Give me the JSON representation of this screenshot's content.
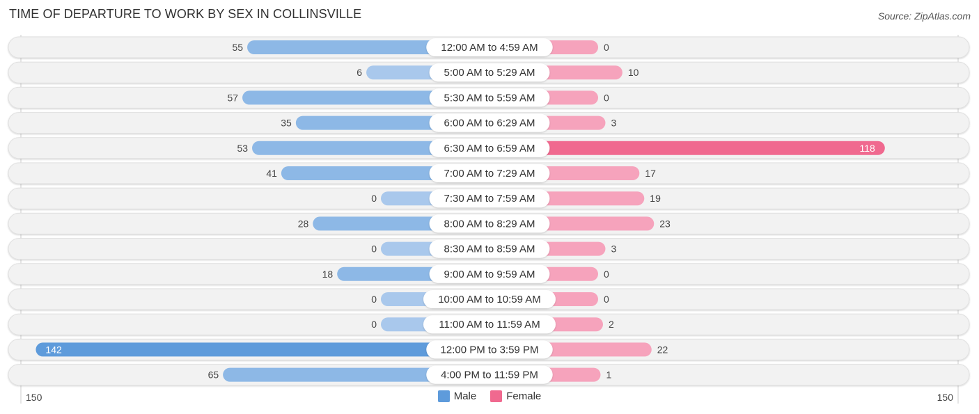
{
  "header": {
    "title": "TIME OF DEPARTURE TO WORK BY SEX IN COLLINSVILLE",
    "source": "Source: ZipAtlas.com"
  },
  "colors": {
    "male": "#8db8e6",
    "male_light": "#a9c8ec",
    "male_strong": "#5e9bdb",
    "female": "#f6a3bc",
    "female_strong": "#f0698f",
    "row_bg": "#f2f2f2"
  },
  "legend": {
    "male_label": "Male",
    "female_label": "Female"
  },
  "axis": {
    "left_label": "150",
    "right_label": "150"
  },
  "chart_data": {
    "type": "bar",
    "orientation": "horizontal-diverging",
    "title": "TIME OF DEPARTURE TO WORK BY SEX IN COLLINSVILLE",
    "xlim": [
      -150,
      150
    ],
    "legend_position": "bottom-center",
    "categories": [
      "12:00 AM to 4:59 AM",
      "5:00 AM to 5:29 AM",
      "5:30 AM to 5:59 AM",
      "6:00 AM to 6:29 AM",
      "6:30 AM to 6:59 AM",
      "7:00 AM to 7:29 AM",
      "7:30 AM to 7:59 AM",
      "8:00 AM to 8:29 AM",
      "8:30 AM to 8:59 AM",
      "9:00 AM to 9:59 AM",
      "10:00 AM to 10:59 AM",
      "11:00 AM to 11:59 AM",
      "12:00 PM to 3:59 PM",
      "4:00 PM to 11:59 PM"
    ],
    "series": [
      {
        "name": "Male",
        "values": [
          55,
          6,
          57,
          35,
          53,
          41,
          0,
          28,
          0,
          18,
          0,
          0,
          142,
          65
        ]
      },
      {
        "name": "Female",
        "values": [
          0,
          10,
          0,
          3,
          118,
          17,
          19,
          23,
          3,
          0,
          0,
          2,
          22,
          1
        ]
      }
    ]
  }
}
